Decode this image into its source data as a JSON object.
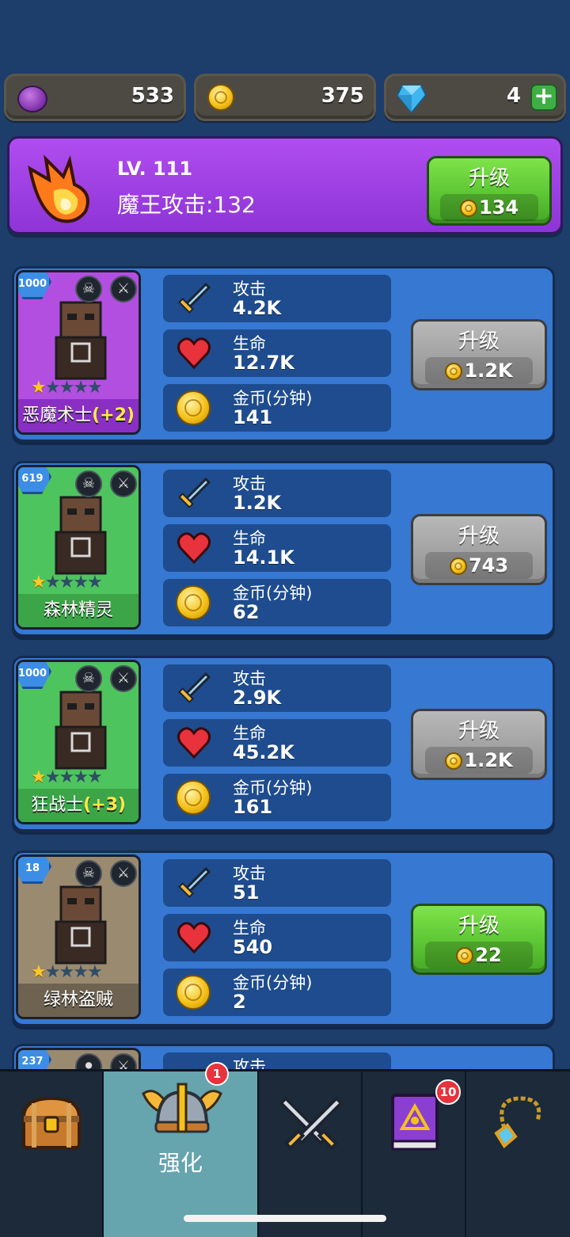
{
  "currencies": {
    "purple_gems": "533",
    "gold_coins": "375",
    "diamonds": "4"
  },
  "boss": {
    "level": "LV. 111",
    "attack_label": "魔王攻击:132",
    "upgrade_label": "升级",
    "upgrade_cost": "134"
  },
  "heroes": [
    {
      "name": "恶魔术士",
      "bonus": "(+2)",
      "level": "1000",
      "stars": 1,
      "attack_label": "攻击",
      "attack": "4.2K",
      "hp_label": "生命",
      "hp": "12.7K",
      "gold_label": "金币(分钟)",
      "gold": "141",
      "upgrade_label": "升级",
      "upgrade_cost": "1.2K",
      "upgrade_available": false,
      "card_color": "#b24fe0",
      "name_bar_color": "#8a2fc4"
    },
    {
      "name": "森林精灵",
      "bonus": "",
      "level": "619",
      "stars": 1,
      "attack_label": "攻击",
      "attack": "1.2K",
      "hp_label": "生命",
      "hp": "14.1K",
      "gold_label": "金币(分钟)",
      "gold": "62",
      "upgrade_label": "升级",
      "upgrade_cost": "743",
      "upgrade_available": false,
      "card_color": "#4ec45e",
      "name_bar_color": "#3ba548"
    },
    {
      "name": "狂战士",
      "bonus": "(+3)",
      "level": "1000",
      "stars": 1,
      "attack_label": "攻击",
      "attack": "2.9K",
      "hp_label": "生命",
      "hp": "45.2K",
      "gold_label": "金币(分钟)",
      "gold": "161",
      "upgrade_label": "升级",
      "upgrade_cost": "1.2K",
      "upgrade_available": false,
      "card_color": "#4ec45e",
      "name_bar_color": "#3ba548"
    },
    {
      "name": "绿林盗贼",
      "bonus": "",
      "level": "18",
      "stars": 1,
      "attack_label": "攻击",
      "attack": "51",
      "hp_label": "生命",
      "hp": "540",
      "gold_label": "金币(分钟)",
      "gold": "2",
      "upgrade_label": "升级",
      "upgrade_cost": "22",
      "upgrade_available": true,
      "card_color": "#9a8a70",
      "name_bar_color": "#6e6250"
    }
  ],
  "partial_hero": {
    "level": "237",
    "attack_label": "攻击"
  },
  "nav": {
    "tabs": [
      {
        "id": "chest",
        "label": "",
        "icon": "treasure-chest-icon"
      },
      {
        "id": "upgrade",
        "label": "强化",
        "icon": "winged-helmet-icon",
        "badge": "1",
        "active": true
      },
      {
        "id": "battle",
        "label": "",
        "icon": "crossed-swords-icon"
      },
      {
        "id": "spellbook",
        "label": "",
        "icon": "spellbook-icon",
        "badge": "10"
      },
      {
        "id": "amulet",
        "label": "",
        "icon": "amulet-icon"
      }
    ]
  }
}
